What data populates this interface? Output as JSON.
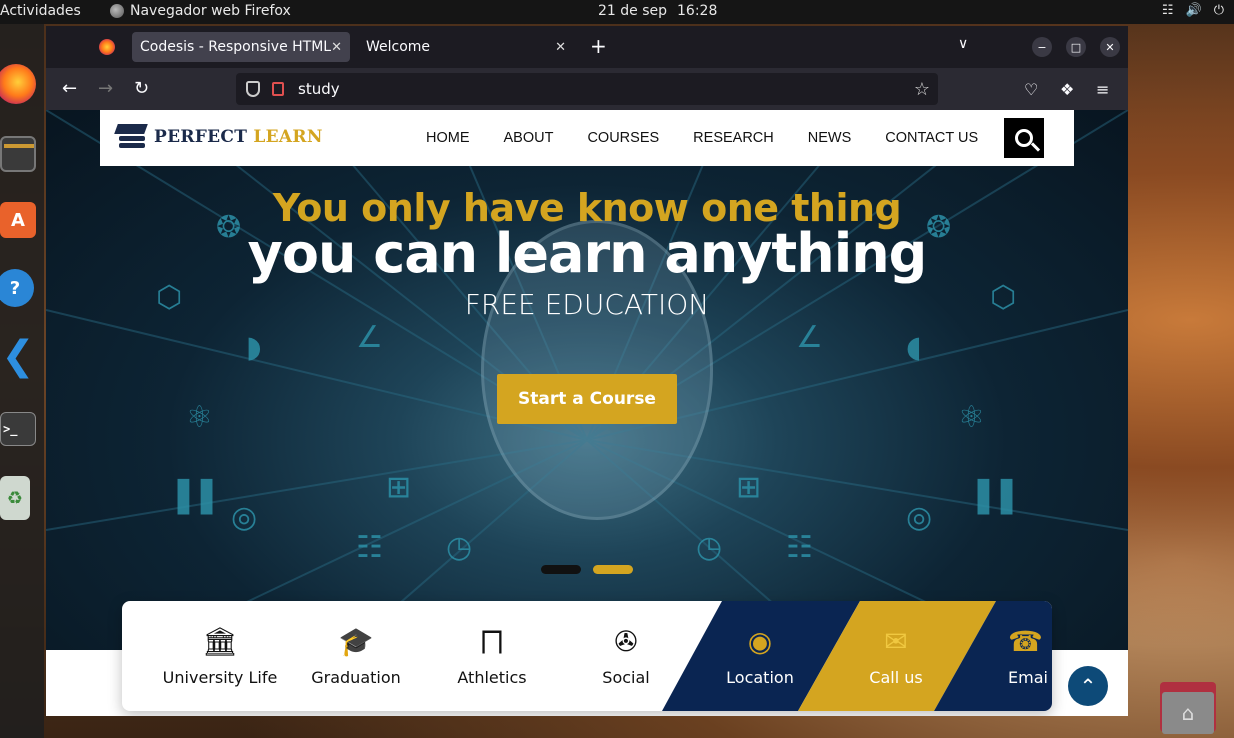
{
  "system": {
    "activities": "Actividades",
    "app_name": "Navegador web Firefox",
    "date": "21 de sep",
    "time": "16:28"
  },
  "browser": {
    "tabs": [
      {
        "title": "Codesis - Responsive HTML5",
        "active": true
      },
      {
        "title": "Welcome",
        "active": false
      }
    ],
    "url": "study"
  },
  "site": {
    "logo": {
      "word1": "PERFECT",
      "word2": "LEARN"
    },
    "menu": [
      "HOME",
      "ABOUT",
      "COURSES",
      "RESEARCH",
      "NEWS",
      "CONTACT US"
    ],
    "hero": {
      "line1": "You only have know one thing",
      "line2": "you can learn anything",
      "line3": "FREE EDUCATION",
      "cta": "Start a Course"
    },
    "features": [
      {
        "label": "University Life",
        "icon": "building-icon"
      },
      {
        "label": "Graduation",
        "icon": "graduation-cap-icon"
      },
      {
        "label": "Athletics",
        "icon": "hurdle-icon"
      },
      {
        "label": "Social",
        "icon": "network-icon"
      },
      {
        "label": "Location",
        "icon": "map-pin-icon"
      },
      {
        "label": "Call us",
        "icon": "envelope-icon"
      },
      {
        "label": "Emai",
        "icon": "telephone-icon"
      }
    ]
  },
  "colors": {
    "brand_navy": "#1b2a4a",
    "brand_gold": "#d4a520",
    "feature_navy": "#0a2552"
  }
}
